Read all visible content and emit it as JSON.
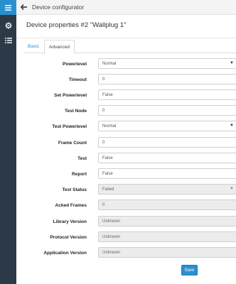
{
  "topbar": {
    "title": "Device configurator"
  },
  "heading": "Device properties #2 \"Wallplug 1\"",
  "tabs": [
    {
      "label": "Basic"
    },
    {
      "label": "Advanced"
    }
  ],
  "fields": [
    {
      "label": "Powerlevel",
      "value": "Normal",
      "kind": "select"
    },
    {
      "label": "Timeout",
      "value": "0",
      "kind": "input"
    },
    {
      "label": "Set Powerlevel",
      "value": "False",
      "kind": "input"
    },
    {
      "label": "Test Node",
      "value": "0",
      "kind": "input"
    },
    {
      "label": "Test Powerlevel",
      "value": "Normal",
      "kind": "select"
    },
    {
      "label": "Frame Count",
      "value": "0",
      "kind": "input"
    },
    {
      "label": "Test",
      "value": "False",
      "kind": "input"
    },
    {
      "label": "Report",
      "value": "False",
      "kind": "input"
    },
    {
      "label": "Test Status",
      "value": "Failed",
      "kind": "select-disabled"
    },
    {
      "label": "Acked Frames",
      "value": "0",
      "kind": "disabled"
    },
    {
      "label": "Library Version",
      "value": "Unknown",
      "kind": "disabled"
    },
    {
      "label": "Protocol Version",
      "value": "Unknown",
      "kind": "disabled"
    },
    {
      "label": "Application Version",
      "value": "Unknown",
      "kind": "disabled"
    }
  ],
  "save_label": "Save",
  "colors": {
    "sidebar": "#2c3a47",
    "accent": "#2a8fcf"
  },
  "icons": {
    "sidebar": [
      "menu-icon",
      "gear-icon",
      "list-icon"
    ],
    "back": "arrow-left-icon",
    "caret": "caret-down-icon"
  }
}
